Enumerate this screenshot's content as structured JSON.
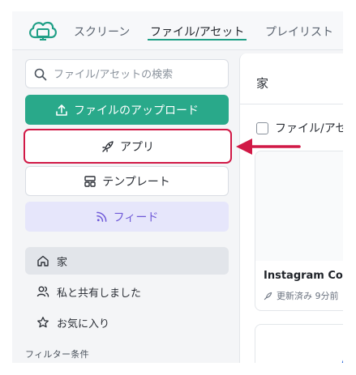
{
  "topnav": {
    "tabs": [
      {
        "label": "スクリーン"
      },
      {
        "label": "ファイル/アセット",
        "active": true
      },
      {
        "label": "プレイリスト"
      }
    ]
  },
  "sidebar": {
    "search": {
      "placeholder": "ファイル/アセットの検索",
      "value": ""
    },
    "upload_label": "ファイルのアップロード",
    "app_label": "アプリ",
    "template_label": "テンプレート",
    "feed_label": "フィード",
    "nav": [
      {
        "label": "家",
        "icon": "home-icon",
        "selected": true
      },
      {
        "label": "私と共有しました",
        "icon": "users-icon"
      },
      {
        "label": "お気に入り",
        "icon": "star-icon"
      }
    ],
    "filter_label": "フィルター条件"
  },
  "main": {
    "title": "家",
    "select_all_label": "ファイル/アセ",
    "card": {
      "title": "Instagram Cou",
      "meta": "更新済み 9分前"
    }
  },
  "colors": {
    "accent": "#1f9f86",
    "upload_button": "#29a98a",
    "highlight_border": "#d11946",
    "feed_bg": "#e6e6fb",
    "feed_text": "#6f5ad8"
  }
}
